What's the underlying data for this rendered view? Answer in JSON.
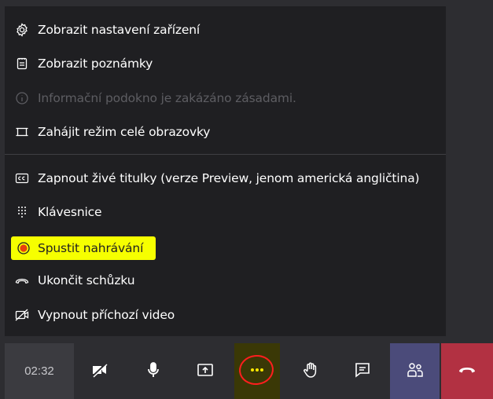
{
  "menu": {
    "items": [
      {
        "label": "Zobrazit nastavení zařízení",
        "icon": "gear-icon"
      },
      {
        "label": "Zobrazit poznámky",
        "icon": "notes-icon"
      },
      {
        "label": "Informační podokno je zakázáno zásadami.",
        "icon": "info-icon",
        "disabled": true
      },
      {
        "label": "Zahájit režim celé obrazovky",
        "icon": "fullscreen-icon"
      },
      {
        "label": "Zapnout živé titulky (verze Preview, jenom americká angličtina)",
        "icon": "captions-icon"
      },
      {
        "label": "Klávesnice",
        "icon": "dialpad-icon"
      },
      {
        "label": "Spustit nahrávání",
        "icon": "record-icon",
        "highlighted": true
      },
      {
        "label": "Ukončit schůzku",
        "icon": "hangup-icon"
      },
      {
        "label": "Vypnout příchozí video",
        "icon": "video-off-icon"
      }
    ]
  },
  "toolbar": {
    "timer": "02:32",
    "buttons": [
      {
        "name": "camera-off-button",
        "icon": "camera-off-icon"
      },
      {
        "name": "microphone-button",
        "icon": "microphone-icon"
      },
      {
        "name": "share-screen-button",
        "icon": "share-screen-icon"
      },
      {
        "name": "more-actions-button",
        "icon": "more-icon"
      },
      {
        "name": "raise-hand-button",
        "icon": "hand-icon"
      },
      {
        "name": "chat-button",
        "icon": "chat-icon"
      },
      {
        "name": "participants-button",
        "icon": "participants-icon"
      },
      {
        "name": "hang-up-button",
        "icon": "hangup-icon"
      }
    ]
  },
  "colors": {
    "menu_bg": "#1f1f22",
    "toolbar_bg": "#2d2d31",
    "highlight": "#f6ff00",
    "record_dot": "#e8410c",
    "hangup": "#b23142",
    "participants": "#4b4b7a",
    "annotation_circle": "#ff1e1e"
  }
}
